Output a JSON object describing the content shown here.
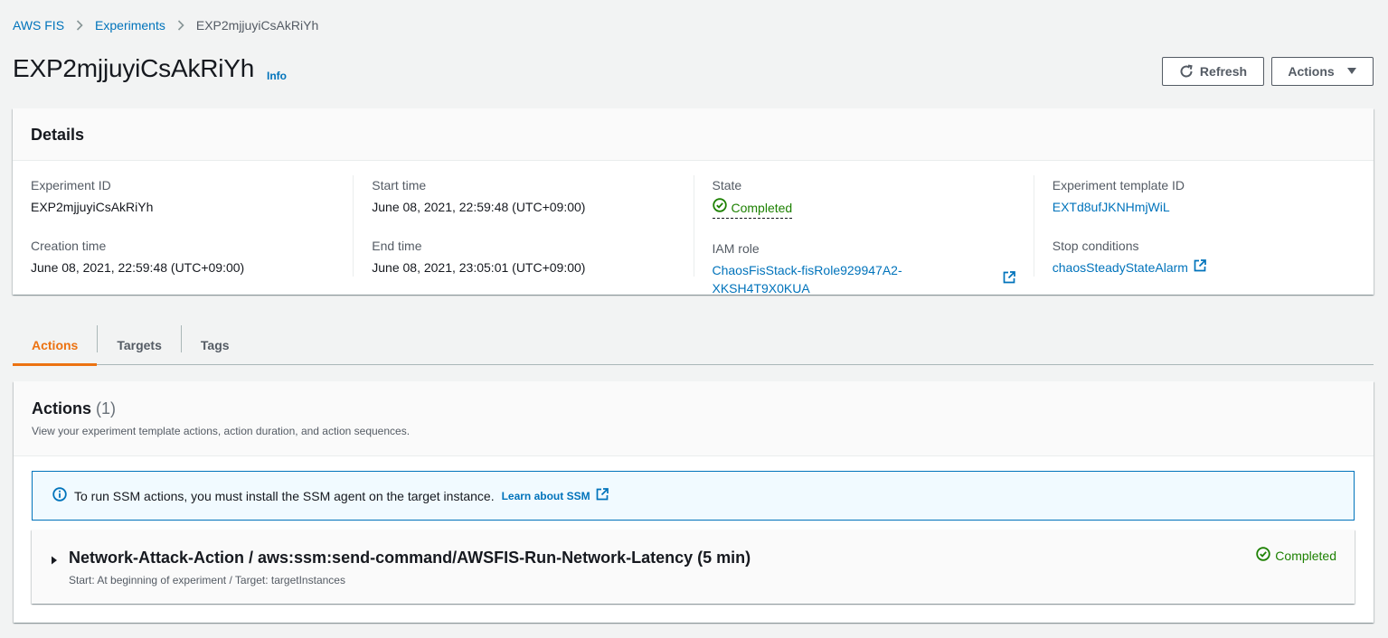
{
  "breadcrumb": {
    "items": [
      "AWS FIS",
      "Experiments"
    ],
    "current": "EXP2mjjuyiCsAkRiYh"
  },
  "header": {
    "title": "EXP2mjjuyiCsAkRiYh",
    "info": "Info",
    "refresh_label": "Refresh",
    "actions_label": "Actions"
  },
  "details": {
    "title": "Details",
    "experiment_id_label": "Experiment ID",
    "experiment_id": "EXP2mjjuyiCsAkRiYh",
    "creation_time_label": "Creation time",
    "creation_time": "June 08, 2021, 22:59:48 (UTC+09:00)",
    "start_time_label": "Start time",
    "start_time": "June 08, 2021, 22:59:48 (UTC+09:00)",
    "end_time_label": "End time",
    "end_time": "June 08, 2021, 23:05:01 (UTC+09:00)",
    "state_label": "State",
    "state": "Completed",
    "iam_role_label": "IAM role",
    "iam_role": "ChaosFisStack-fisRole929947A2-XKSH4T9X0KUA",
    "template_id_label": "Experiment template ID",
    "template_id": "EXTd8ufJKNHmjWiL",
    "stop_conditions_label": "Stop conditions",
    "stop_conditions": "chaosSteadyStateAlarm"
  },
  "tabs": [
    {
      "label": "Actions"
    },
    {
      "label": "Targets"
    },
    {
      "label": "Tags"
    }
  ],
  "actions_panel": {
    "title": "Actions",
    "count": "(1)",
    "description": "View your experiment template actions, action duration, and action sequences.",
    "alert_text": "To run SSM actions, you must install the SSM agent on the target instance.",
    "alert_link": "Learn about SSM",
    "item": {
      "name": "Network-Attack-Action / aws:ssm:send-command/AWSFIS-Run-Network-Latency (5 min)",
      "subtitle": "Start: At beginning of experiment / Target: targetInstances",
      "status": "Completed"
    }
  },
  "colors": {
    "link": "#0073bb",
    "success": "#1d8102",
    "active_tab": "#ec7211",
    "background": "#f2f3f3"
  }
}
